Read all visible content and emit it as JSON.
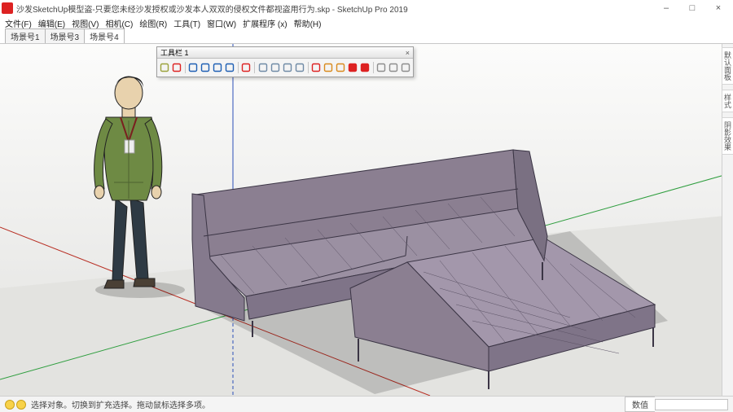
{
  "window": {
    "title": "沙发SketchUp模型盗-只要您未经沙发授权或沙发本人双双的侵权文件都视盗用行为.skp - SketchUp Pro 2019",
    "min": "–",
    "max": "□",
    "close": "×"
  },
  "menu": {
    "items": [
      "文件(F)",
      "编辑(E)",
      "视图(V)",
      "相机(C)",
      "绘图(R)",
      "工具(T)",
      "窗口(W)",
      "扩展程序 (x)",
      "帮助(H)"
    ]
  },
  "scenes": {
    "tabs": [
      "场景号1",
      "场景号3",
      "场景号4"
    ],
    "active": 2
  },
  "toolbar": {
    "title": "工具栏 1",
    "close": "×",
    "tools": [
      {
        "name": "edit-icon",
        "color": "#9aa13b"
      },
      {
        "name": "rect-icon",
        "color": "#d22"
      },
      {
        "sep": true
      },
      {
        "name": "select-blue-1",
        "color": "#1e5fb4"
      },
      {
        "name": "select-blue-2",
        "color": "#1e5fb4"
      },
      {
        "name": "select-blue-3",
        "color": "#1e5fb4"
      },
      {
        "name": "select-blue-4",
        "color": "#1e5fb4"
      },
      {
        "sep": true
      },
      {
        "name": "red-dot-icon",
        "color": "#d22"
      },
      {
        "sep": true
      },
      {
        "name": "globe-1-icon",
        "color": "#6f8aa6"
      },
      {
        "name": "globe-2-icon",
        "color": "#6f8aa6"
      },
      {
        "name": "globe-3-icon",
        "color": "#6f8aa6"
      },
      {
        "name": "globe-4-icon",
        "color": "#6f8aa6"
      },
      {
        "sep": true
      },
      {
        "name": "gear-icon",
        "color": "#d22"
      },
      {
        "name": "box-icon",
        "color": "#d98a1d"
      },
      {
        "name": "cube-icon",
        "color": "#d98a1d"
      },
      {
        "name": "camera-red-icon",
        "color": "#d22",
        "fill": true
      },
      {
        "name": "camera2-red-icon",
        "color": "#d22",
        "fill": true
      },
      {
        "sep": true
      },
      {
        "name": "link-icon",
        "color": "#8d8d8d"
      },
      {
        "name": "page-icon",
        "color": "#8d8d8d"
      },
      {
        "name": "arrow-icon",
        "color": "#8d8d8d"
      }
    ]
  },
  "tray": {
    "labels": [
      "默认面板",
      "样式",
      "阴影效果"
    ]
  },
  "status": {
    "msg": "选择对象。切换到扩充选择。拖动鼠标选择多项。",
    "measure_label": "数值"
  },
  "colors": {
    "axis_red": "#b82f24",
    "axis_green": "#2f9e3f",
    "axis_blue": "#2b4fb8",
    "sofa": "#8b7f91",
    "sofa_line": "#3b3545",
    "shirt": "#6e8a44",
    "pants": "#2e3a44",
    "skin": "#e8d2ad",
    "hair": "#1d1d1d"
  }
}
